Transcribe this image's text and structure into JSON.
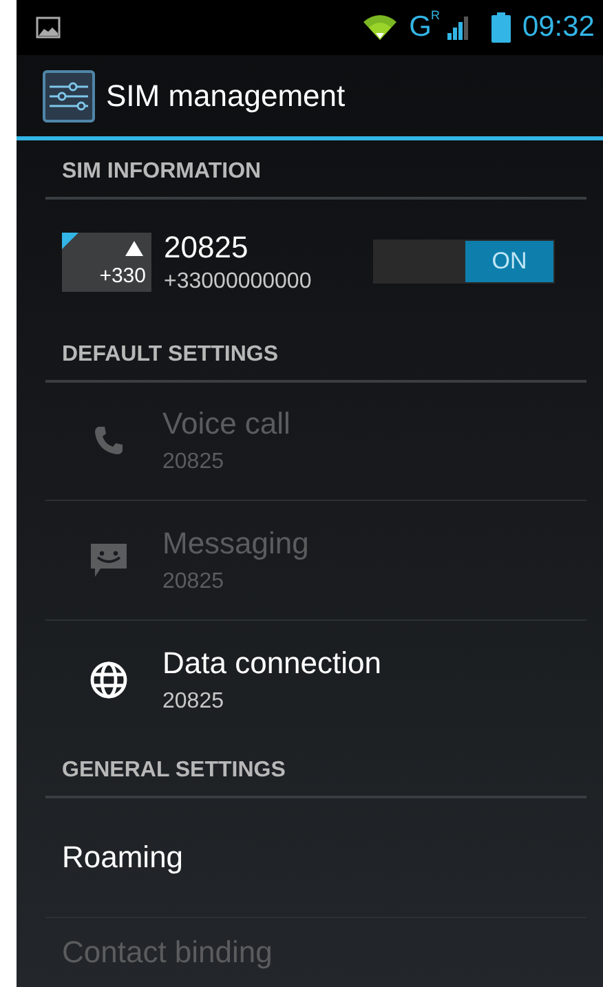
{
  "status_bar": {
    "time": "09:32",
    "network": "G",
    "roaming": "R"
  },
  "app_bar": {
    "title": "SIM management"
  },
  "sim_information": {
    "header": "SIM INFORMATION",
    "sim": {
      "badge": "+330",
      "name": "20825",
      "number": "+33000000000",
      "switch": {
        "label": "ON",
        "on": true
      }
    }
  },
  "default_settings": {
    "header": "DEFAULT SETTINGS",
    "items": [
      {
        "kind": "voice",
        "title": "Voice call",
        "subtitle": "20825",
        "disabled": true
      },
      {
        "kind": "messaging",
        "title": "Messaging",
        "subtitle": "20825",
        "disabled": true
      },
      {
        "kind": "data",
        "title": "Data connection",
        "subtitle": "20825",
        "disabled": false
      }
    ]
  },
  "general_settings": {
    "header": "GENERAL SETTINGS",
    "items": [
      {
        "title": "Roaming",
        "disabled": false
      },
      {
        "title": "Contact binding",
        "disabled": true
      }
    ]
  }
}
